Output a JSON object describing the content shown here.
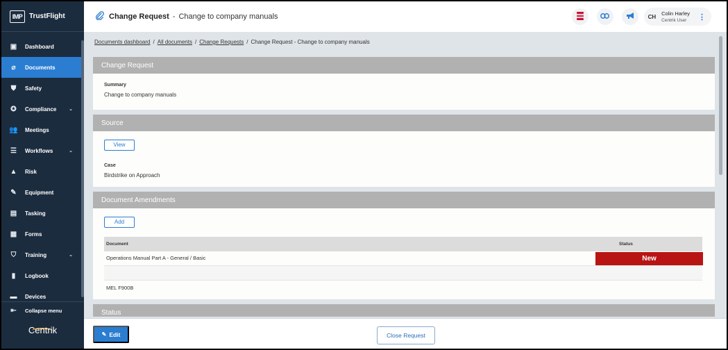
{
  "brand": {
    "logo_text": "IMP",
    "name": "TrustFlight"
  },
  "sidebar": {
    "items": [
      {
        "label": "Dashboard",
        "icon": "dashboard-icon",
        "glyph": "▣",
        "chevron": false
      },
      {
        "label": "Documents",
        "icon": "paperclip-icon",
        "glyph": "⌀",
        "chevron": false,
        "active": true
      },
      {
        "label": "Safety",
        "icon": "shield-icon",
        "glyph": "⛊",
        "chevron": false
      },
      {
        "label": "Compliance",
        "icon": "badge-icon",
        "glyph": "✪",
        "chevron": true
      },
      {
        "label": "Meetings",
        "icon": "people-icon",
        "glyph": "👥",
        "chevron": false
      },
      {
        "label": "Workflows",
        "icon": "layers-icon",
        "glyph": "☰",
        "chevron": true
      },
      {
        "label": "Risk",
        "icon": "warning-icon",
        "glyph": "▲",
        "chevron": false
      },
      {
        "label": "Equipment",
        "icon": "wrench-icon",
        "glyph": "✎",
        "chevron": false
      },
      {
        "label": "Tasking",
        "icon": "clipboard-icon",
        "glyph": "▤",
        "chevron": false
      },
      {
        "label": "Forms",
        "icon": "form-icon",
        "glyph": "▦",
        "chevron": false
      },
      {
        "label": "Training",
        "icon": "graduation-cap-icon",
        "glyph": "⛉",
        "chevron": true
      },
      {
        "label": "Logbook",
        "icon": "book-icon",
        "glyph": "▮",
        "chevron": false
      },
      {
        "label": "Devices",
        "icon": "device-icon",
        "glyph": "▬",
        "chevron": false
      }
    ],
    "collapse_label": "Collapse menu",
    "footer_brand": "Centrik"
  },
  "header": {
    "title": "Change Request",
    "separator": "-",
    "subtitle": "Change to company manuals",
    "user": {
      "initials": "CH",
      "name": "Colin Harley",
      "role": "Centrik User"
    }
  },
  "breadcrumb": {
    "items": [
      "Documents dashboard",
      "All documents",
      "Change Requests"
    ],
    "current": "Change Request - Change to company manuals",
    "separator": "/"
  },
  "sections": {
    "change_request": {
      "title": "Change Request",
      "summary_label": "Summary",
      "summary_value": "Change to company manuals"
    },
    "source": {
      "title": "Source",
      "view_label": "View",
      "case_label": "Case",
      "case_value": "Birdstrike on Approach"
    },
    "amendments": {
      "title": "Document Amendments",
      "add_label": "Add",
      "columns": [
        "Document",
        "Status"
      ],
      "rows": [
        {
          "document": "Operations Manual Part A - General / Basic",
          "status": "New"
        },
        {
          "document": "",
          "status": ""
        },
        {
          "document": "MEL F900B",
          "status": ""
        }
      ]
    },
    "status": {
      "title": "Status"
    }
  },
  "footer": {
    "edit_label": "Edit",
    "close_label": "Close Request"
  },
  "colors": {
    "accent": "#2a7dd1",
    "sidebar": "#1c2c3f",
    "section_header": "#b1b1b1",
    "status_new": "#b81414"
  }
}
